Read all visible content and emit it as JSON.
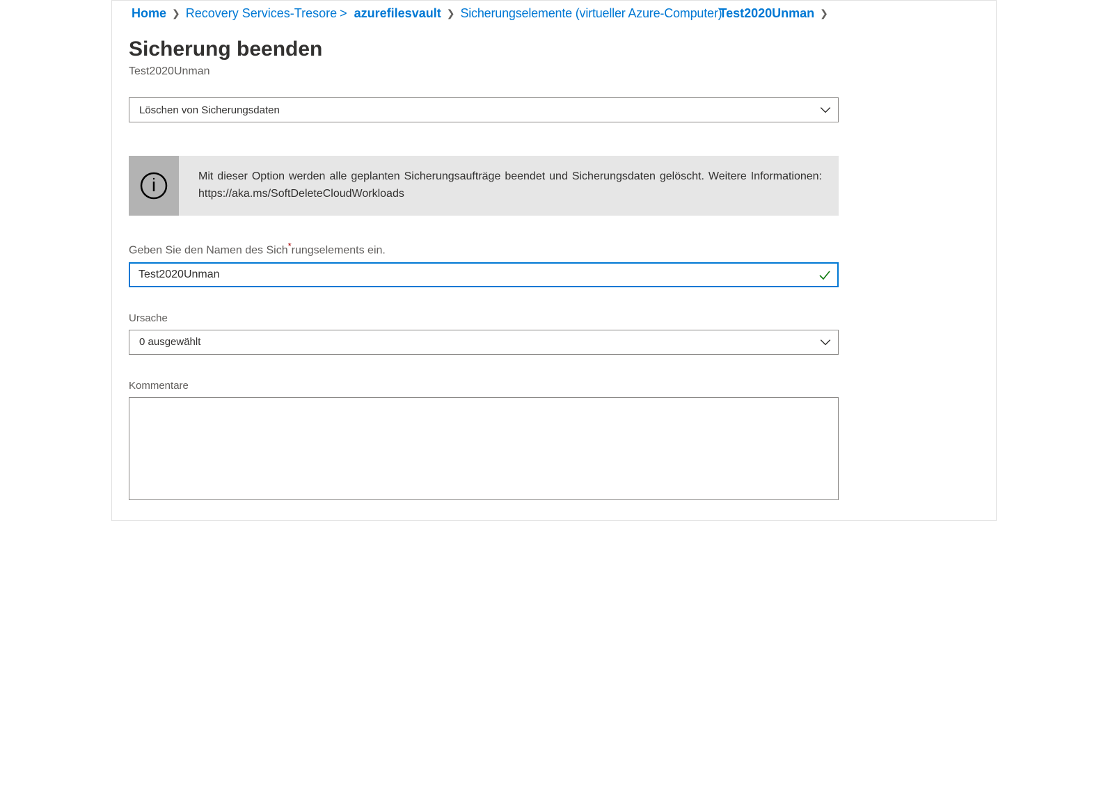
{
  "breadcrumb": {
    "home": "Home",
    "recovery": "Recovery Services-Tresore",
    "vault": "azurefilesvault",
    "items": "Sicherungselemente (virtueller Azure-Computer)",
    "current": "Test2020Unman"
  },
  "page": {
    "title": "Sicherung beenden",
    "subtitle": "Test2020Unman"
  },
  "action_select": {
    "value": "Löschen von Sicherungsdaten"
  },
  "info": {
    "text": "Mit dieser Option werden alle geplanten Sicherungsaufträge beendet und Sicherungsdaten gelöscht. Weitere Informationen: ",
    "link": "https://aka.ms/SoftDeleteCloudWorkloads"
  },
  "name_field": {
    "label_pre": "Geben Sie den Namen des Sich",
    "label_post": "rungselements ein.",
    "value": "Test2020Unman"
  },
  "reason": {
    "label": "Ursache",
    "value": "0 ausgewählt"
  },
  "comments": {
    "label": "Kommentare",
    "value": ""
  }
}
